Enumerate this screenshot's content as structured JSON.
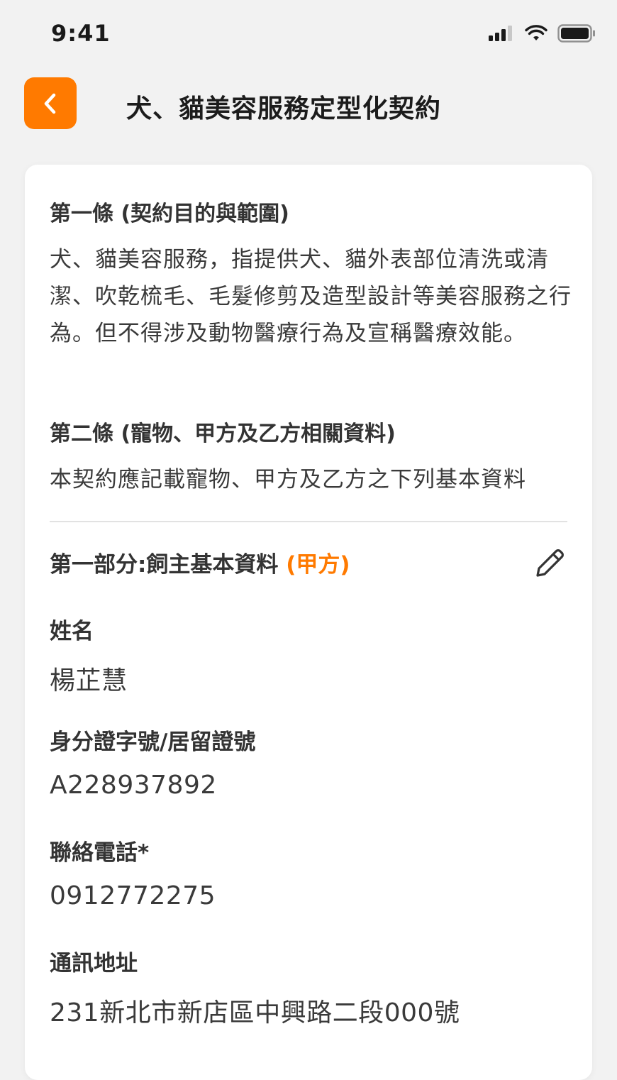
{
  "status_bar": {
    "time": "9:41"
  },
  "header": {
    "title": "犬、貓美容服務定型化契約"
  },
  "colors": {
    "accent": "#ff7a00",
    "background": "#f2f2f2",
    "card": "#ffffff"
  },
  "articles": [
    {
      "title": "第一條 (契約目的與範圍)",
      "body": "犬、貓美容服務，指提供犬、貓外表部位清洗或清潔、吹乾梳毛、毛髮修剪及造型設計等美容服務之行為。但不得涉及動物醫療行為及宣稱醫療效能。"
    },
    {
      "title": "第二條 (寵物、甲方及乙方相關資料)",
      "body": "本契約應記載寵物、甲方及乙方之下列基本資料"
    }
  ],
  "part_one": {
    "title": "第一部分:飼主基本資料",
    "party": "(甲方)",
    "fields": [
      {
        "label": "姓名",
        "value": "楊芷慧"
      },
      {
        "label": "身分證字號/居留證號",
        "value": "A228937892"
      },
      {
        "label": "聯絡電話*",
        "value": "0912772275"
      },
      {
        "label": "通訊地址",
        "value": "231新北市新店區中興路二段000號"
      }
    ]
  },
  "icons": {
    "back": "chevron-left-icon",
    "edit": "pencil-icon",
    "signal": "signal-icon",
    "wifi": "wifi-icon",
    "battery": "battery-icon"
  }
}
